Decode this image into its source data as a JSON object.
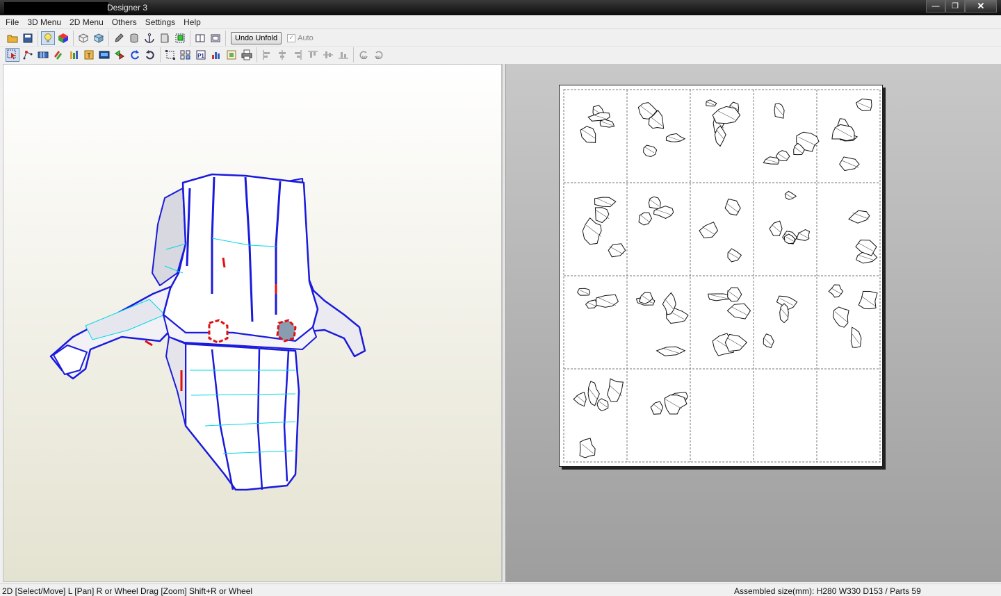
{
  "window": {
    "title": "Designer 3",
    "controls": [
      "minimize",
      "maximize",
      "close"
    ]
  },
  "menu": [
    "File",
    "3D Menu",
    "2D Menu",
    "Others",
    "Settings",
    "Help"
  ],
  "toolbar1": {
    "undo_unfold_label": "Undo Unfold",
    "auto_label": "Auto",
    "auto_checked": true
  },
  "toolbar2": {
    "rotate_90_label": "90",
    "rotate_neg90_label": "90"
  },
  "pane_2d": {
    "page_count": 17,
    "grid_columns": 5,
    "grid_rows": 4
  },
  "status": {
    "left": "2D [Select/Move] L [Pan] R or Wheel Drag [Zoom] Shift+R or Wheel",
    "right": "Assembled size(mm): H280 W330 D153 / Parts 59"
  },
  "colors": {
    "model_edge": "#1a1adc",
    "fold_line": "#00d8e8",
    "cut_edge": "#e01010",
    "titlebar": "#111111"
  }
}
